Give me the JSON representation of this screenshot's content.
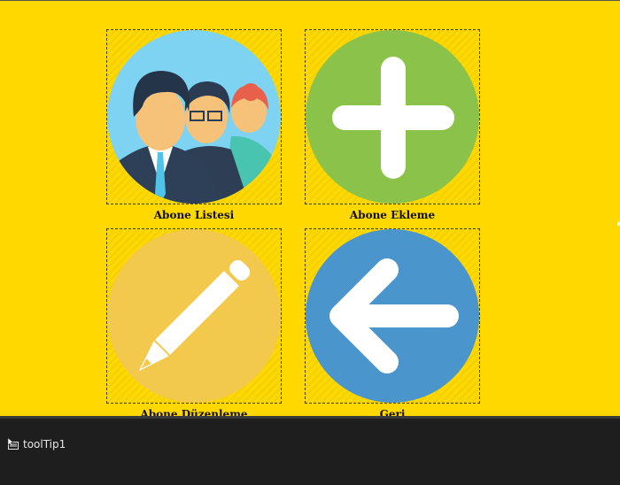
{
  "tiles": {
    "subscriber_list": {
      "label": "Abone Listesi",
      "icon": "people-icon"
    },
    "add_subscriber": {
      "label": "Abone Ekleme",
      "icon": "plus-icon"
    },
    "edit_subscriber": {
      "label": "Abone Düzenleme",
      "icon": "pencil-icon"
    },
    "back": {
      "label": "Geri",
      "icon": "arrow-left-icon"
    }
  },
  "component_tray": {
    "items": [
      {
        "label": "toolTip1",
        "icon": "tooltip-component-icon"
      }
    ]
  },
  "colors": {
    "form_background": "#FFD800",
    "people_circle": "#7FD3F2",
    "plus_circle": "#8BC34A",
    "pencil_circle": "#F2C94C",
    "back_circle": "#4A96CC",
    "tray_background": "#1E1E1E"
  }
}
